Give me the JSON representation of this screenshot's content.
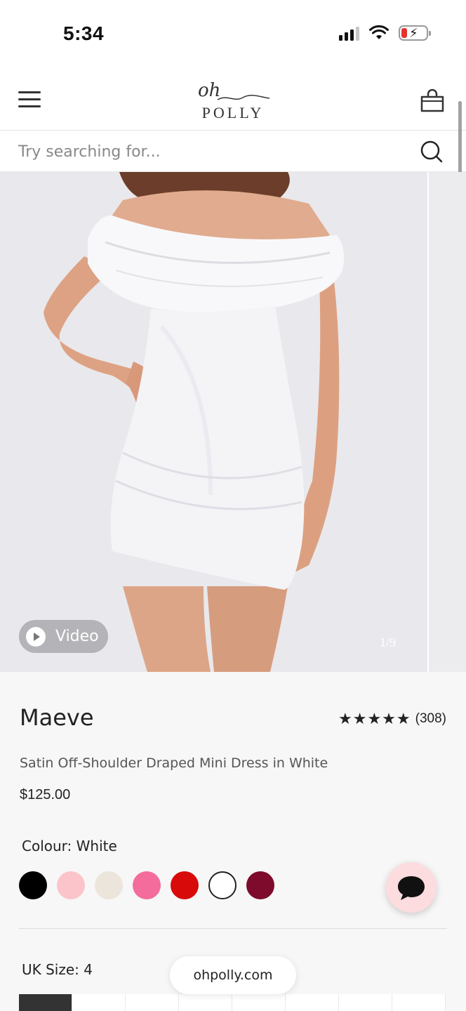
{
  "status_bar": {
    "time": "5:34"
  },
  "brand": {
    "logo_script": "oh",
    "logo_word": "POLLY"
  },
  "search": {
    "placeholder": "Try searching for..."
  },
  "gallery": {
    "video_label": "Video",
    "image_counter": "1/9"
  },
  "product": {
    "name": "Maeve",
    "stars": "★★★★★",
    "review_count": "(308)",
    "subtitle": "Satin Off-Shoulder Draped Mini Dress in White",
    "price": "$125.00",
    "colour_label": "Colour: White",
    "size_label": "UK Size: 4"
  },
  "colours": [
    "#000000",
    "#fbc4cb",
    "#ece5dc",
    "#f46c9c",
    "#d80a0a",
    "#ffffff",
    "#7e0b2b"
  ],
  "selected_colour_index": 5,
  "browser": {
    "url": "ohpolly.com"
  }
}
